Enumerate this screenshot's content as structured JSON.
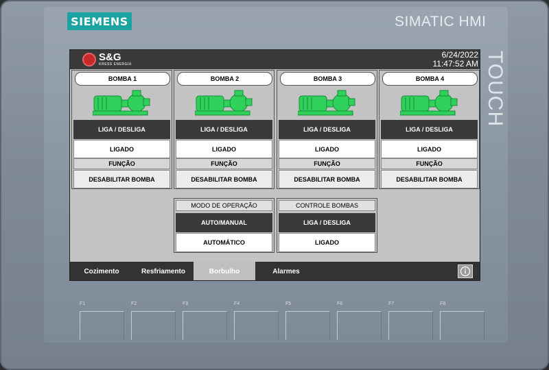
{
  "device": {
    "brand": "SIEMENS",
    "model": "SIMATIC HMI",
    "side_label": "TOUCH",
    "bezel_color": "#7f8a96",
    "brand_color": "#1aa3a0"
  },
  "header": {
    "logo_text": "S&G",
    "logo_subtext": "KRESS ENERGIA",
    "date": "6/24/2022",
    "time": "11:47:52 AM"
  },
  "pumps": [
    {
      "title": "BOMBA 1",
      "toggle_label": "LIGA / DESLIGA",
      "status": "LIGADO",
      "function_label": "FUNÇÃO",
      "disable_label": "DESABILITAR BOMBA"
    },
    {
      "title": "BOMBA 2",
      "toggle_label": "LIGA / DESLIGA",
      "status": "LIGADO",
      "function_label": "FUNÇÃO",
      "disable_label": "DESABILITAR BOMBA"
    },
    {
      "title": "BOMBA 3",
      "toggle_label": "LIGA / DESLIGA",
      "status": "LIGADO",
      "function_label": "FUNÇÃO",
      "disable_label": "DESABILITAR BOMBA"
    },
    {
      "title": "BOMBA 4",
      "toggle_label": "LIGA / DESLIGA",
      "status": "LIGADO",
      "function_label": "FUNÇÃO",
      "disable_label": "DESABILITAR BOMBA"
    }
  ],
  "mode": {
    "header": "MODO DE OPERAÇÃO",
    "button_label": "AUTO/MANUAL",
    "value": "AUTOMÁTICO"
  },
  "pump_control": {
    "header": "CONTROLE BOMBAS",
    "button_label": "LIGA / DESLIGA",
    "value": "LIGADO"
  },
  "nav": {
    "items": [
      "Cozimento",
      "Resfriamento",
      "Borbulho",
      "Alarmes"
    ],
    "active": "Borbulho",
    "info_icon": "info-icon"
  },
  "function_keys": [
    "F1",
    "F2",
    "F3",
    "F4",
    "F5",
    "F6",
    "F7",
    "F8"
  ],
  "colors": {
    "pump_green": "#2fd15a",
    "screen_bg": "#c3c3c3",
    "bar_dark": "#3a3a3a",
    "logo_red": "#c62a2a"
  }
}
